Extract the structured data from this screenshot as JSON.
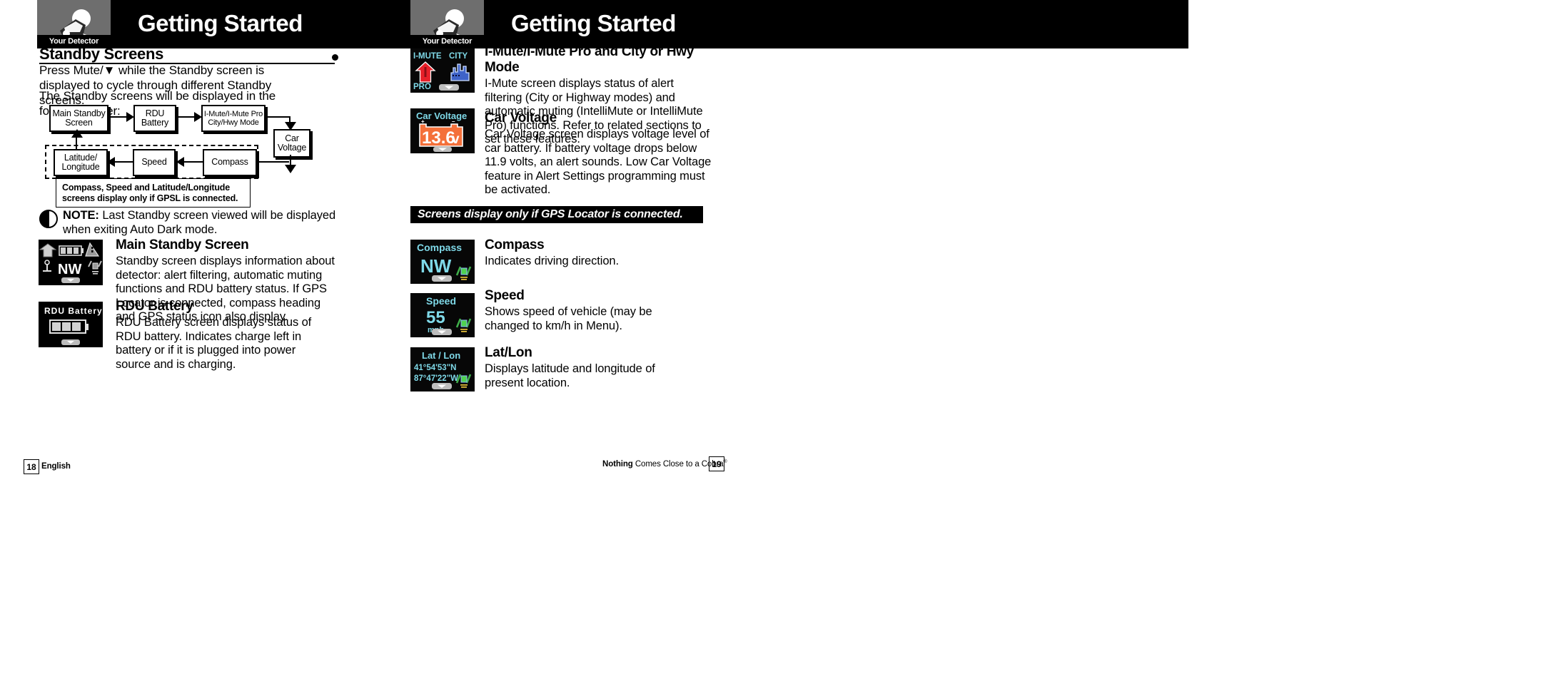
{
  "header": {
    "logo_label": "Your Detector",
    "title_left": "Getting Started",
    "title_right": "Getting Started"
  },
  "left_page": {
    "section_title": "Standby Screens",
    "intro_1": "Press Mute/▼  while the Standby screen is displayed to cycle through different Standby screens.",
    "intro_2": "The Standby screens will be displayed in the following order:",
    "diagram": {
      "boxes": [
        {
          "id": "main-standby",
          "label": "Main Standby\nScreen"
        },
        {
          "id": "rdu-battery",
          "label": "RDU\nBattery"
        },
        {
          "id": "imute-pro",
          "label": "I-Mute/I-Mute Pro\nCity/Hwy Mode"
        },
        {
          "id": "car-voltage",
          "label": "Car\nVoltage"
        },
        {
          "id": "compass",
          "label": "Compass"
        },
        {
          "id": "speed",
          "label": "Speed"
        },
        {
          "id": "lat-long",
          "label": "Latitude/\nLongitude"
        }
      ],
      "gpsl_note": "Compass, Speed and Latitude/Longitude screens display only if GPSL is connected."
    },
    "note": {
      "label": "NOTE:",
      "text": " Last Standby screen viewed will be displayed when exiting Auto Dark mode."
    },
    "figures": [
      {
        "id": "main-standby-screen",
        "heading": "Main Standby Screen",
        "body": "Standby screen displays information about detector: alert filtering, automatic muting functions and RDU battery status. If GPS Locator is connected, compass heading and GPS status icon also display.",
        "screen": {
          "type": "main-standby",
          "direction": "NW"
        }
      },
      {
        "id": "rdu-battery-screen",
        "heading": "RDU Battery",
        "body": "RDU Battery screen displays status of RDU battery. Indicates charge left in battery or if it is plugged into power source and is charging.",
        "screen": {
          "type": "rdu-battery",
          "title": "RDU  Battery"
        }
      }
    ]
  },
  "right_page": {
    "figures_top": [
      {
        "id": "imute-city-hwy",
        "heading": "I-Mute/I-Mute Pro and City or Hwy Mode",
        "body": "I-Mute screen displays status of alert filtering (City or Highway modes) and automatic muting (IntelliMute or IntelliMute Pro) functions. Refer to related sections to set these features.",
        "screen": {
          "type": "imute",
          "label_left": "I-MUTE",
          "label_right": "CITY",
          "label_bottom": "PRO"
        }
      },
      {
        "id": "car-voltage-figure",
        "heading": "Car Voltage",
        "body": "Car Voltage screen displays voltage level of car battery. If battery voltage drops below 11.9 volts, an alert sounds. Low Car Voltage feature in Alert Settings programming must be activated.",
        "screen": {
          "type": "car-voltage",
          "title": "Car Voltage",
          "value": "13.6",
          "unit": "v",
          "plus": "+",
          "minus": "–"
        }
      }
    ],
    "banner": "Screens display only if GPS Locator is connected.",
    "figures_gps": [
      {
        "id": "compass-figure",
        "heading": "Compass",
        "body": "Indicates driving direction.",
        "screen": {
          "type": "compass",
          "title": "Compass",
          "value": "NW"
        }
      },
      {
        "id": "speed-figure",
        "heading": "Speed",
        "body": "Shows speed of vehicle (may be changed to km/h in Menu).",
        "screen": {
          "type": "speed",
          "title": "Speed",
          "value": "55",
          "unit": "mph"
        }
      },
      {
        "id": "latlon-figure",
        "heading": "Lat/Lon",
        "body": "Displays latitude and longitude of present location.",
        "screen": {
          "type": "latlon",
          "title": "Lat / Lon",
          "lat": "41°54'53\"N",
          "lon": "87°47'22\"W"
        }
      }
    ]
  },
  "footer": {
    "page_left": "18",
    "language": "English",
    "tagline_a": "Nothing",
    "tagline_b": " Comes Close to a Cobra",
    "tagline_sup": "®",
    "page_right": "19"
  },
  "colors": {
    "lcd_cyan": "#7fd9e8",
    "lcd_red": "#e8202a",
    "lcd_blue": "#3f63c8",
    "lcd_orange": "#f4703a",
    "header_black": "#000000",
    "logo_gray": "#6e6e6e"
  }
}
